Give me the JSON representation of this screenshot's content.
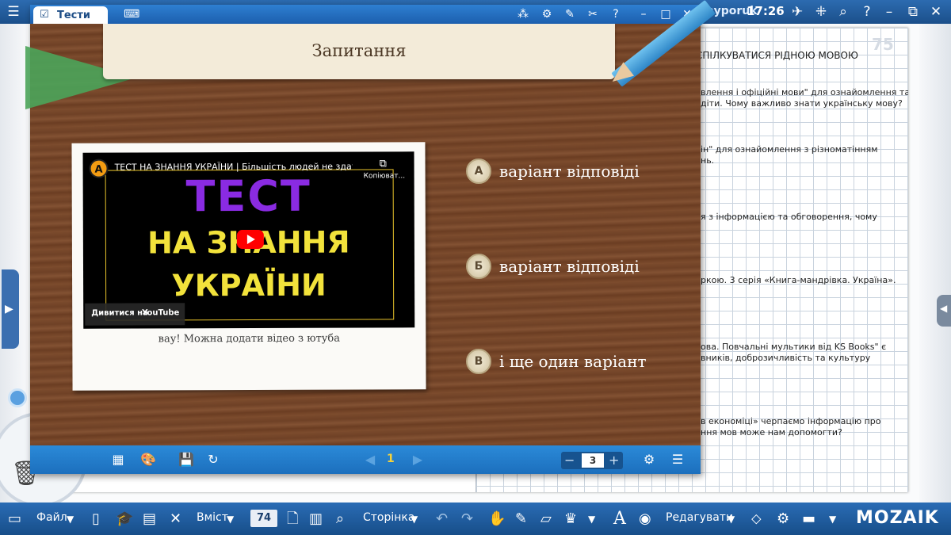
{
  "top_bar": {
    "user": "myporuk",
    "clock": "17:26"
  },
  "test_window": {
    "tab_title": "Тести",
    "question_title": "Запитання",
    "video": {
      "title": "ТЕСТ НА ЗНАННЯ УКРАЇНИ | Більшість людей не здатні ...",
      "copy_label": "Копіюват...",
      "big_line1": "ТЕСТ",
      "big_line2": "НА ЗНАННЯ",
      "big_line3": "УКРАЇНИ",
      "watch_on": "Дивитися на",
      "youtube": "YouTube",
      "channel_letter": "A"
    },
    "media_caption": "вау! Можна додати відео з ютуба",
    "answers": [
      {
        "badge": "А",
        "text": "варіант відповіді"
      },
      {
        "badge": "Б",
        "text": "варіант відповіді"
      },
      {
        "badge": "В",
        "text": "і ще один варіант"
      }
    ],
    "bottom_bar": {
      "current_page": "1",
      "zoom_value": "3"
    }
  },
  "book": {
    "page_number": "75",
    "heading": "СПІЛКУВАТИСЯ РІДНОЮ МОВОЮ",
    "lines": [
      "влення і офіційні мови\" для ознайомлення та",
      "діти. Чому важливо знати українську мову?",
      "ін\" для ознайомлення з різноматінням",
      "нь.",
      "я з інформацією та обговорення, чому",
      "ркою. 3 серія «Книга-мандрівка. Україна».",
      "ова. Повчальні мультики від KS Books\" є",
      "вників, доброзичливість та культуру",
      "в економіці» черпаємо інформацію про",
      "ння мов може нам допомогти?"
    ]
  },
  "bottom_bar": {
    "file": "Файл",
    "content": "Вміст",
    "page_field": "74",
    "page": "Сторінка",
    "edit": "Редагувати",
    "logo": "MOZAIK"
  }
}
